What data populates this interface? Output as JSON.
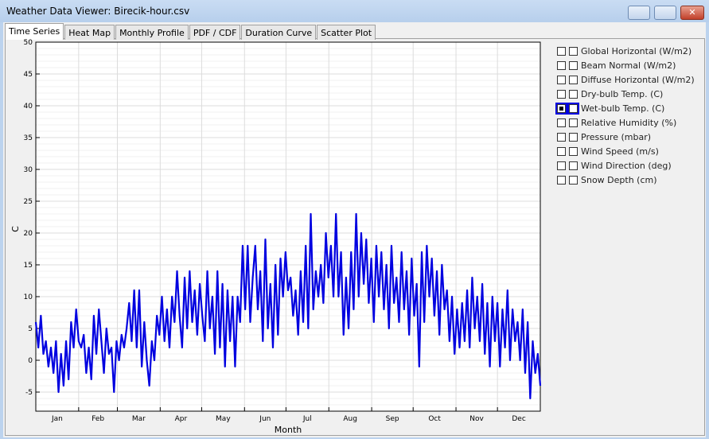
{
  "window": {
    "title": "Weather Data Viewer: Birecik-hour.csv",
    "controls": [
      "minimize",
      "maximize",
      "close"
    ]
  },
  "tabs": [
    {
      "label": "Time Series",
      "active": true
    },
    {
      "label": "Heat Map"
    },
    {
      "label": "Monthly Profile"
    },
    {
      "label": "PDF / CDF"
    },
    {
      "label": "Duration Curve"
    },
    {
      "label": "Scatter Plot"
    }
  ],
  "variables": [
    {
      "label": "Global Horizontal (W/m2)",
      "left": false,
      "right": false
    },
    {
      "label": "Beam Normal (W/m2)",
      "left": false,
      "right": false
    },
    {
      "label": "Diffuse Horizontal (W/m2)",
      "left": false,
      "right": false
    },
    {
      "label": "Dry-bulb Temp. (C)",
      "left": false,
      "right": false
    },
    {
      "label": "Wet-bulb Temp. (C)",
      "left": true,
      "right": false
    },
    {
      "label": "Relative Humidity (%)",
      "left": false,
      "right": false
    },
    {
      "label": "Pressure (mbar)",
      "left": false,
      "right": false
    },
    {
      "label": "Wind Speed (m/s)",
      "left": false,
      "right": false
    },
    {
      "label": "Wind Direction (deg)",
      "left": false,
      "right": false
    },
    {
      "label": "Snow Depth (cm)",
      "left": false,
      "right": false
    }
  ],
  "chart_data": {
    "type": "line",
    "xlabel": "Month",
    "ylabel": "C",
    "ylim": [
      -8,
      50
    ],
    "xlim_days": [
      0,
      365
    ],
    "yticks": [
      -5,
      0,
      5,
      10,
      15,
      20,
      25,
      30,
      35,
      40,
      45,
      50
    ],
    "month_labels": [
      "Jan",
      "Feb",
      "Mar",
      "Apr",
      "May",
      "Jun",
      "Jul",
      "Aug",
      "Sep",
      "Oct",
      "Nov",
      "Dec"
    ],
    "grid": true,
    "line_color": "#0000e0",
    "series": [
      {
        "values": [
          6,
          2,
          7,
          1,
          3,
          -1,
          2,
          -2,
          3,
          -5,
          1,
          -4,
          3,
          -3,
          6,
          2,
          8,
          3,
          2,
          4,
          -2,
          2,
          -3,
          7,
          1,
          8,
          3,
          -2,
          5,
          1,
          2,
          -5,
          3,
          0,
          4,
          2,
          5,
          9,
          3,
          11,
          2,
          11,
          -1,
          6,
          0,
          -4,
          3,
          0,
          7,
          4,
          10,
          3,
          8,
          2,
          10,
          6,
          14,
          7,
          2,
          13,
          5,
          14,
          6,
          11,
          4,
          12,
          7,
          3,
          14,
          5,
          10,
          1,
          14,
          2,
          12,
          -1,
          11,
          3,
          10,
          -1,
          10,
          6,
          18,
          8,
          18,
          6,
          13,
          18,
          8,
          14,
          3,
          19,
          5,
          12,
          2,
          15,
          4,
          16,
          10,
          17,
          11,
          13,
          7,
          11,
          4,
          14,
          6,
          18,
          5,
          23,
          8,
          14,
          10,
          15,
          9,
          20,
          13,
          18,
          10,
          23,
          10,
          17,
          4,
          13,
          5,
          17,
          8,
          23,
          10,
          20,
          12,
          19,
          9,
          16,
          6,
          18,
          10,
          17,
          8,
          15,
          5,
          18,
          9,
          13,
          6,
          17,
          8,
          14,
          4,
          16,
          7,
          12,
          -1,
          17,
          6,
          18,
          10,
          16,
          7,
          14,
          4,
          15,
          8,
          11,
          3,
          10,
          1,
          8,
          2,
          9,
          3,
          11,
          2,
          13,
          5,
          10,
          3,
          12,
          1,
          9,
          -1,
          10,
          3,
          9,
          -1,
          8,
          2,
          11,
          0,
          8,
          3,
          6,
          0,
          8,
          -2,
          6,
          -6,
          3,
          -2,
          1,
          -4
        ]
      }
    ]
  }
}
